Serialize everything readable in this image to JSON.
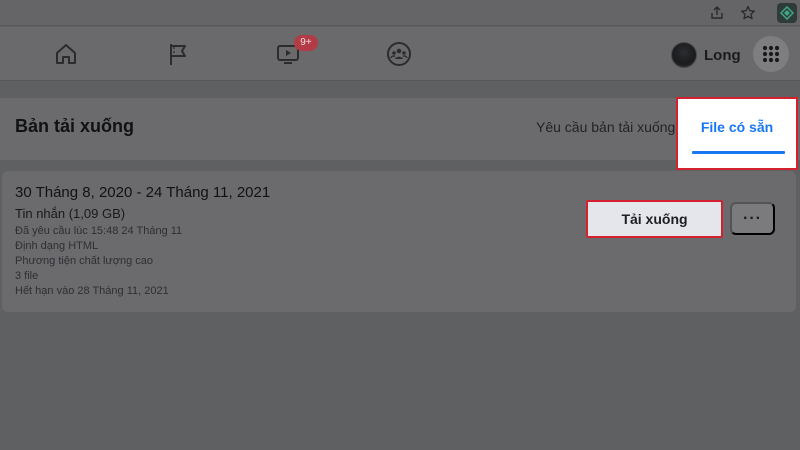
{
  "nav": {
    "watch_badge": "9+",
    "profile_name": "Long"
  },
  "header": {
    "title": "Bản tải xuống",
    "tabs": [
      {
        "label": "Yêu cầu bản tải xuống",
        "active": false
      },
      {
        "label": "File có sẵn",
        "active": true
      }
    ]
  },
  "file": {
    "date_range": "30 Tháng 8, 2020 - 24 Tháng 11, 2021",
    "type": "Tin nhắn (1,09 GB)",
    "details": [
      "Đã yêu cầu lúc 15:48 24 Tháng 11",
      "Định dạng HTML",
      "Phương tiện chất lượng cao",
      "3 file",
      "Hết hạn vào 28 Tháng 11, 2021"
    ],
    "download_label": "Tải xuống",
    "more_label": "···"
  },
  "colors": {
    "accent": "#1877f2",
    "highlight_border": "#d32130",
    "badge": "#b33b45"
  },
  "icons": [
    "share-icon",
    "star-icon",
    "extension-icon",
    "home-icon",
    "pages-flag-icon",
    "watch-video-icon",
    "groups-icon",
    "menu-grid-icon"
  ]
}
